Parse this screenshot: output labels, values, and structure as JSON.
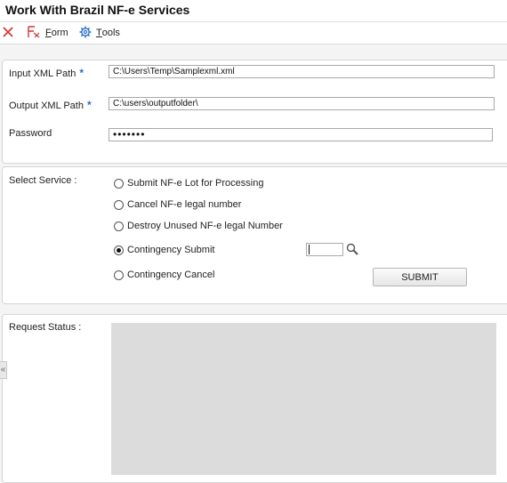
{
  "window": {
    "title": "Work With Brazil NF-e Services"
  },
  "toolbar": {
    "close_icon": "close-icon",
    "form_prefix": "F",
    "form_suffix": "orm",
    "tools_prefix": "T",
    "tools_suffix": "ools"
  },
  "fields": {
    "input_xml": {
      "label": "Input XML Path",
      "value": "C:\\Users\\Temp\\Samplexml.xml",
      "required": "*"
    },
    "output_xml": {
      "label": "Output XML Path",
      "value": "C:\\users\\outputfolder\\",
      "required": "*"
    },
    "password": {
      "label": "Password",
      "value": "•••••••"
    }
  },
  "service": {
    "label": "Select Service :",
    "options": [
      {
        "label": "Submit NF-e Lot for Processing",
        "checked": false
      },
      {
        "label": "Cancel NF-e legal number",
        "checked": false
      },
      {
        "label": "Destroy Unused NF-e legal Number",
        "checked": false
      },
      {
        "label": "Contingency Submit",
        "checked": true
      },
      {
        "label": "Contingency Cancel",
        "checked": false
      }
    ],
    "contingency_value": "",
    "submit_label": "SUBMIT"
  },
  "status": {
    "label": "Request Status :",
    "collapse_glyph": "«"
  },
  "colors": {
    "accent": "#2a6fc9",
    "close_icon": "#d0342c",
    "status_box": "#dcdcdc"
  }
}
